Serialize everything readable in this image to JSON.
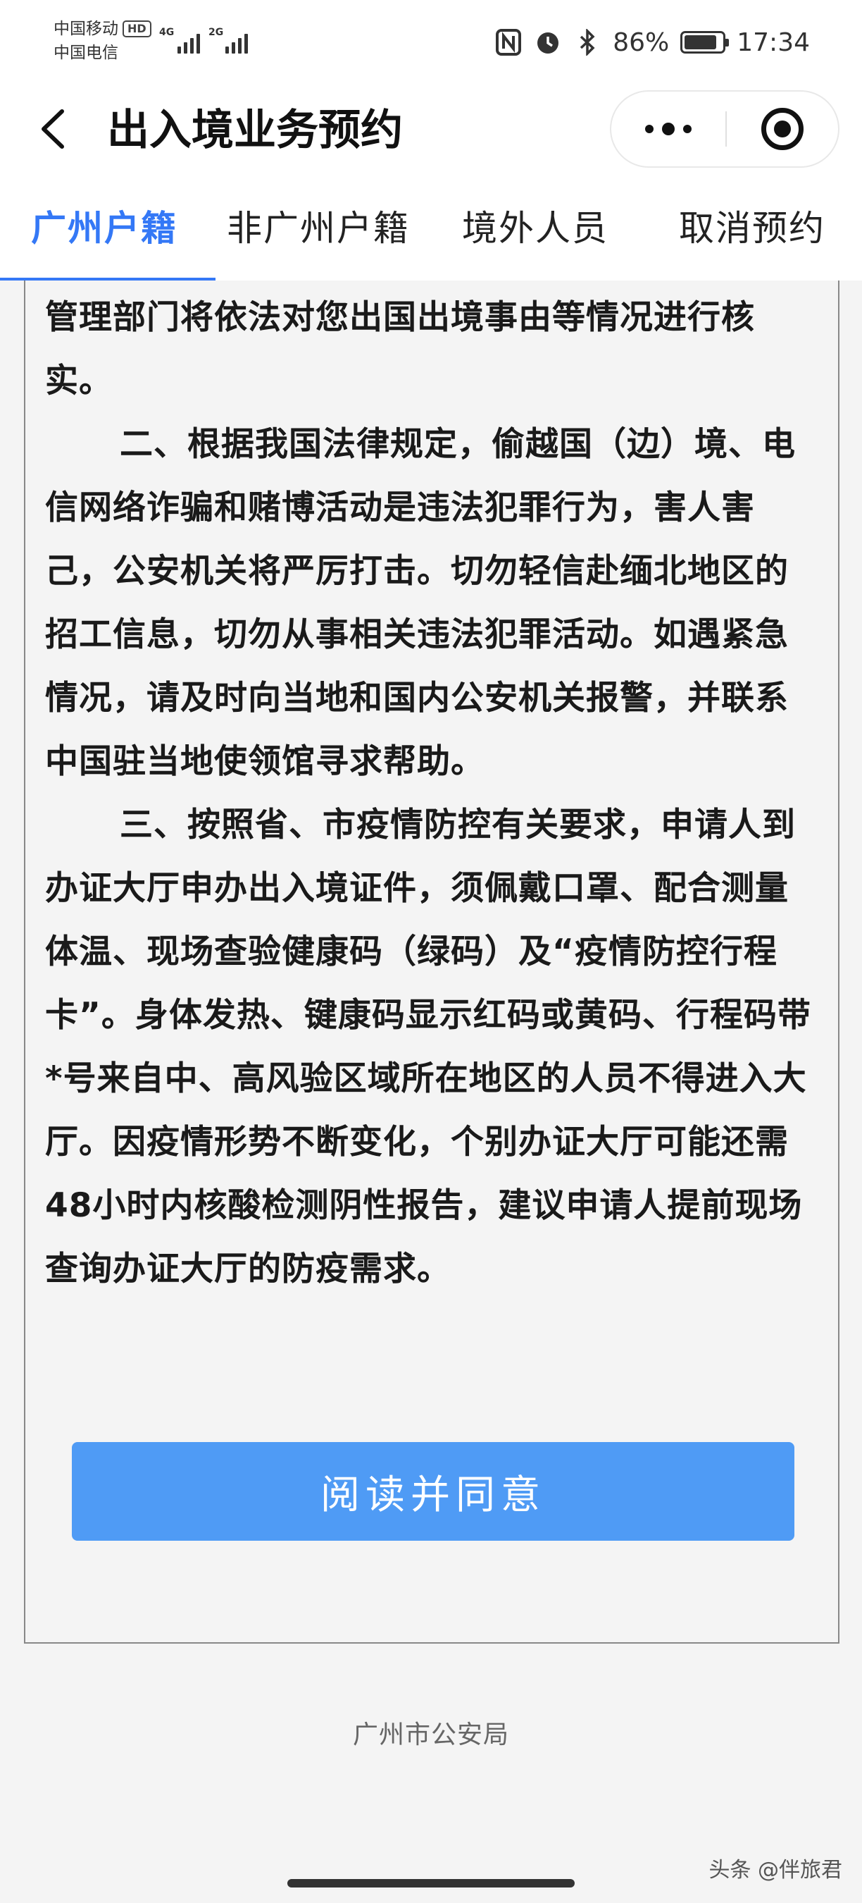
{
  "status_bar": {
    "carrier_1": "中国移动",
    "carrier_1_badge": "HD",
    "carrier_2": "中国电信",
    "network_1": "4G",
    "network_2": "2G",
    "battery_percent": "86%",
    "battery_level": 0.86,
    "time": "17:34"
  },
  "header": {
    "title": "出入境业务预约"
  },
  "tabs": [
    {
      "label": "广州户籍",
      "active": true
    },
    {
      "label": "非广州户籍",
      "active": false
    },
    {
      "label": "境外人员",
      "active": false
    },
    {
      "label": "取消预约",
      "active": false
    }
  ],
  "notice": {
    "intro": "管理部门将依法对您出国出境事由等情况进行核实。",
    "item_2": "二、根据我国法律规定，偷越国（边）境、电信网络诈骗和赌博活动是违法犯罪行为，害人害己，公安机关将严厉打击。切勿轻信赴缅北地区的招工信息，切勿从事相关违法犯罪活动。如遇紧急情况，请及时向当地和国内公安机关报警，并联系中国驻当地使领馆寻求帮助。",
    "item_3": "三、按照省、市疫情防控有关要求，申请人到办证大厅申办出入境证件，须佩戴口罩、配合测量体温、现场查验健康码（绿码）及“疫情防控行程卡”。身体发热、键康码显示红码或黄码、行程码带*号来自中、高风验区域所在地区的人员不得进入大厅。因疫情形势不断变化，个别办证大厅可能还需48小时内核酸检测阴性报告，建议申请人提前现场查询办证大厅的防疫需求。",
    "agree_button": "阅读并同意"
  },
  "footer": {
    "agency": "广州市公安局",
    "watermark": "头条 @伴旅君"
  },
  "colors": {
    "accent": "#3478f6",
    "button": "#4f9bf5",
    "background": "#f4f4f4"
  }
}
